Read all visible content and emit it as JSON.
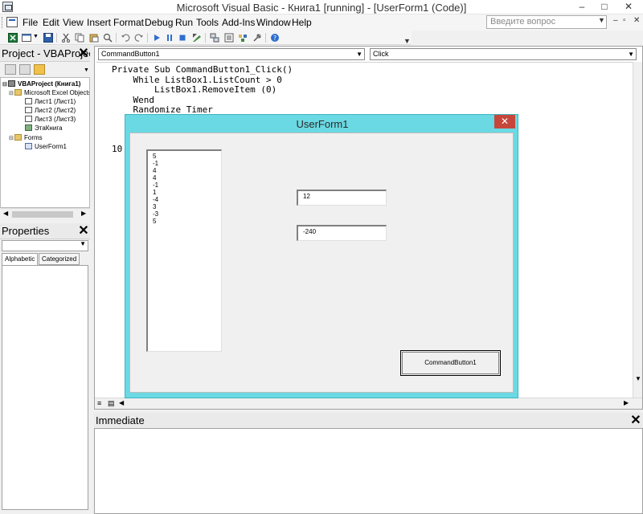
{
  "title_bar": {
    "title": "Microsoft Visual Basic - Книга1 [running] - [UserForm1 (Code)]",
    "minimize": "–",
    "maximize": "□",
    "close": "✕"
  },
  "menu": {
    "items": [
      "File",
      "Edit",
      "View",
      "Insert",
      "Format",
      "Debug",
      "Run",
      "Tools",
      "Add-Ins",
      "Window",
      "Help"
    ],
    "ask_placeholder": "Введите вопрос"
  },
  "project_panel": {
    "title": "Project - VBAProject",
    "tree": [
      {
        "label": "VBAProject (Книга1)",
        "level": 0,
        "icon": "project-icon"
      },
      {
        "label": "Microsoft Excel Objects",
        "level": 1,
        "icon": "folder-icon"
      },
      {
        "label": "Лист1 (Лист1)",
        "level": 2,
        "icon": "sheet-icon"
      },
      {
        "label": "Лист2 (Лист2)",
        "level": 2,
        "icon": "sheet-icon"
      },
      {
        "label": "Лист3 (Лист3)",
        "level": 2,
        "icon": "sheet-icon"
      },
      {
        "label": "ЭтаКнига",
        "level": 2,
        "icon": "workbook-icon"
      },
      {
        "label": "Forms",
        "level": 1,
        "icon": "folder-icon"
      },
      {
        "label": "UserForm1",
        "level": 2,
        "icon": "form-icon"
      }
    ]
  },
  "properties_panel": {
    "title": "Properties",
    "tabs": [
      "Alphabetic",
      "Categorized"
    ]
  },
  "code_window": {
    "object_combo": "CommandButton1",
    "procedure_combo": "Click",
    "lines": [
      "Private Sub CommandButton1_Click()",
      "    While ListBox1.ListCount > 0",
      "        ListBox1.RemoveItem (0)",
      "    Wend",
      "    Randomize Timer"
    ],
    "partial_text": "10"
  },
  "immediate": {
    "title": "Immediate"
  },
  "userform": {
    "title": "UserForm1",
    "close": "✕",
    "listbox_items": [
      "5",
      "-1",
      "4",
      "4",
      "-1",
      "1",
      "-4",
      "3",
      "-3",
      "5"
    ],
    "textbox1": "12",
    "textbox2": "-240",
    "button_label": "CommandButton1"
  }
}
